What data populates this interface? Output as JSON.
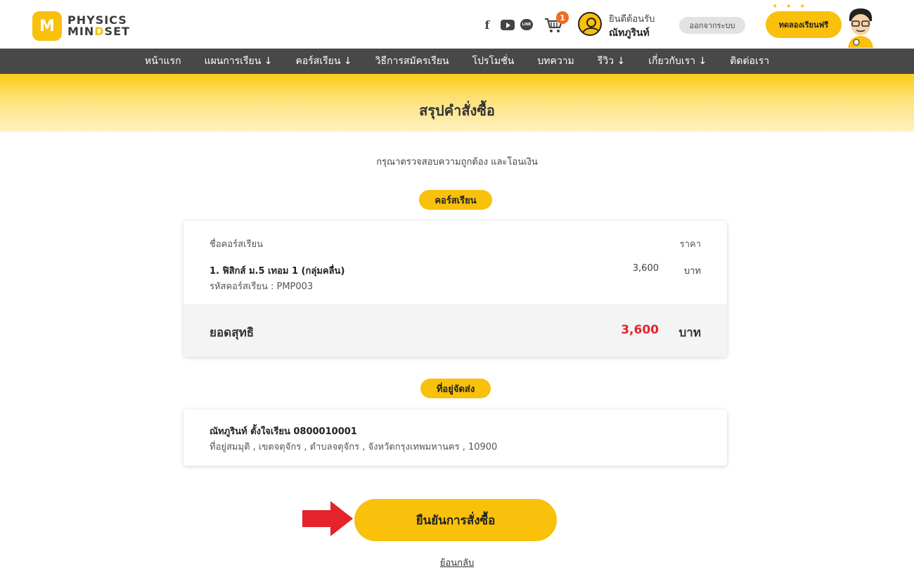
{
  "header": {
    "logo_mark": "M",
    "logo_line1": "PHYSICS",
    "logo_line2_a": "MIN",
    "logo_line2_b": "D",
    "logo_line2_c": "SET",
    "social_facebook": "f",
    "social_line": "LINE",
    "cart_count": "1",
    "welcome_label": "ยินดีต้อนรับ",
    "username": "ณัทภูรินท์",
    "logout_label": "ออกจากระบบ",
    "trial_label": "ทดลองเรียนฟรี",
    "icons": [
      "logo",
      "facebook-icon",
      "youtube-icon",
      "line-icon",
      "cart-icon",
      "user-avatar-icon",
      "mascot-illustration"
    ]
  },
  "nav": {
    "items": [
      "หน้าแรก",
      "แผนการเรียน ↓",
      "คอร์สเรียน ↓",
      "วิธีการสมัครเรียน",
      "โปรโมชั่น",
      "บทความ",
      "รีวิว ↓",
      "เกี่ยวกับเรา ↓",
      "ติดต่อเรา"
    ]
  },
  "banner": {
    "title": "สรุปคำสั่งซื้อ"
  },
  "subtitle": "กรุณาตรวจสอบความถูกต้อง และโอนเงิน",
  "course_section": {
    "pill": "คอร์สเรียน",
    "header_name": "ชื่อคอร์สเรียน",
    "header_price": "ราคา",
    "item_name": "1. ฟิสิกส์ ม.5 เทอม 1 (กลุ่มคลื่น)",
    "item_code": "รหัสคอร์สเรียน : PMP003",
    "item_price": "3,600",
    "item_unit": "บาท",
    "total_label": "ยอดสุทธิ",
    "total_value": "3,600",
    "total_unit": "บาท"
  },
  "address_section": {
    "pill": "ที่อยู่จัดส่ง",
    "name_phone": "ณัทภูรินท์ ตั้งใจเรียน 0800010001",
    "address": "ที่อยู่สมมุติ , เขตจตุจักร , ตำบลจตุจักร , จังหวัดกรุงเทพมหานคร , 10900"
  },
  "actions": {
    "confirm_label": "ยืนยันการสั่งซื้อ",
    "back_label": "ย้อนกลับ"
  },
  "colors": {
    "brand_yellow": "#f9c00c",
    "nav_bg": "#484848",
    "total_red": "#e4232a",
    "arrow_red": "#e4232a",
    "cart_badge": "#f26b21"
  }
}
